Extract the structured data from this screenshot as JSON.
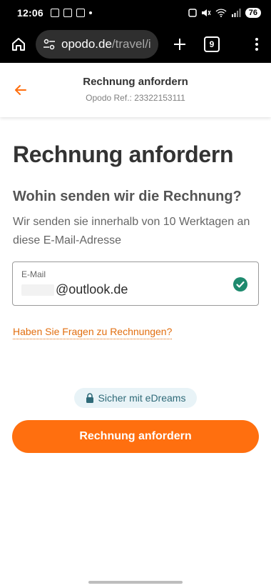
{
  "status_bar": {
    "time": "12:06",
    "battery": "76"
  },
  "browser": {
    "url_domain": "opodo.de",
    "url_path": "/travel/i",
    "tab_count": "9"
  },
  "header": {
    "title": "Rechnung anfordern",
    "reference": "Opodo Ref.: 23322153111"
  },
  "main": {
    "page_title": "Rechnung anfordern",
    "section_title": "Wohin senden wir die Rechnung?",
    "section_description": "Wir senden sie innerhalb von 10 Werktagen an diese E-Mail-Adresse",
    "email_label": "E-Mail",
    "email_value": "@outlook.de",
    "faq_link": "Haben Sie Fragen zu Rechnungen?",
    "secure_badge": "Sicher mit eDreams",
    "submit_button": "Rechnung anfordern"
  },
  "colors": {
    "accent_orange": "#ff6f0f",
    "link_orange": "#e26e0f",
    "check_green": "#1e8a6e",
    "badge_bg": "#e8f3f7"
  },
  "icons": {
    "home": "home-icon",
    "url_settings": "tune-icon",
    "new_tab": "plus-icon",
    "menu": "more-vert-icon",
    "back": "arrow-left-icon",
    "valid": "check-circle-icon",
    "secure": "lock-icon"
  }
}
